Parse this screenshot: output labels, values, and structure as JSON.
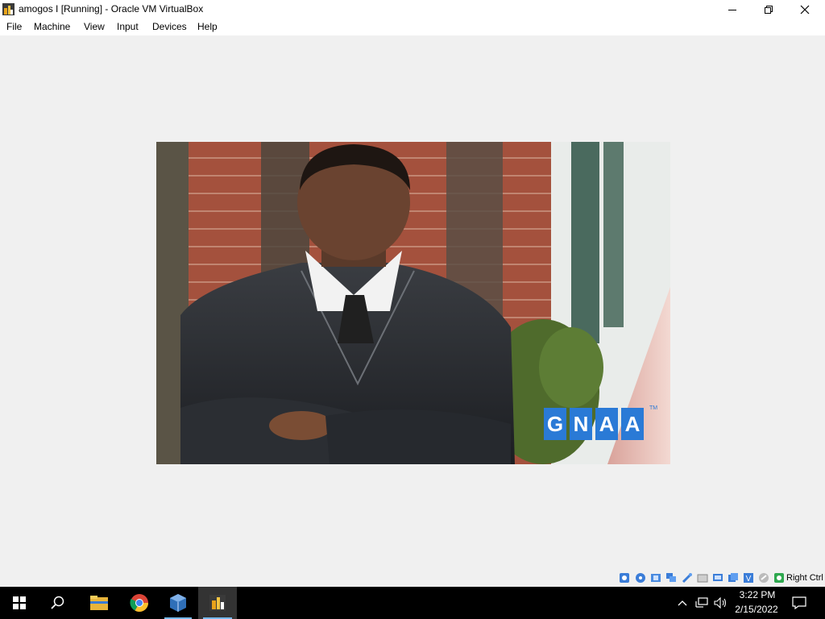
{
  "window": {
    "title": "amogos I [Running] - Oracle VM VirtualBox"
  },
  "menu": [
    {
      "label": "File"
    },
    {
      "label": "Machine"
    },
    {
      "label": "View"
    },
    {
      "label": "Input"
    },
    {
      "label": "Devices"
    },
    {
      "label": "Help"
    }
  ],
  "guest_display": {
    "logo_letters": [
      "G",
      "N",
      "A",
      "A"
    ],
    "logo_tm": "TM"
  },
  "statusbar": {
    "host_key": "Right Ctrl"
  },
  "taskbar": {
    "apps": [
      "start",
      "search",
      "file-explorer",
      "chrome",
      "virtualbox",
      "vm-window"
    ],
    "time": "3:22 PM",
    "date": "2/15/2022"
  },
  "colors": {
    "accent_blue": "#2a7ad6",
    "taskbar": "#000000",
    "active_indicator": "#76b9ed"
  }
}
